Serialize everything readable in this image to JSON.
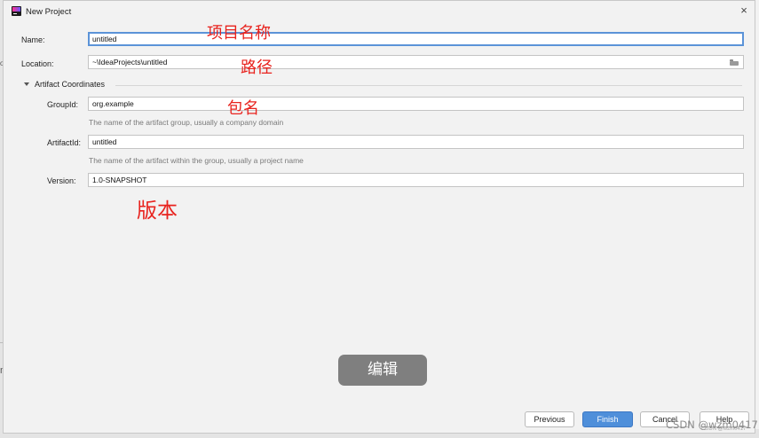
{
  "window": {
    "title": "New Project",
    "close_symbol": "×",
    "icon": "intellij-idea-icon"
  },
  "form": {
    "name": {
      "label": "Name:",
      "value": "untitled"
    },
    "location": {
      "label": "Location:",
      "value": "~\\IdeaProjects\\untitled",
      "icon": "folder-icon"
    },
    "artifact_section": {
      "label": "Artifact Coordinates",
      "expanded": true,
      "group_id": {
        "label": "GroupId:",
        "value": "org.example",
        "hint": "The name of the artifact group, usually a company domain"
      },
      "artifact_id": {
        "label": "ArtifactId:",
        "value": "untitled",
        "hint": "The name of the artifact within the group, usually a project name"
      },
      "version": {
        "label": "Version:",
        "value": "1.0-SNAPSHOT"
      }
    }
  },
  "annotations": {
    "project_name": "项目名称",
    "path": "路径",
    "package_name": "包名",
    "version": "版本",
    "color": "#e8231e"
  },
  "overlay": {
    "edit_label": "编辑"
  },
  "buttons": {
    "previous": "Previous",
    "finish": "Finish",
    "cancel": "Cancel",
    "help": "Help"
  },
  "background_fragments": {
    "left_text": "ol",
    "left_text_2": "n"
  },
  "watermark": {
    "text": "CSDN @wzm0417",
    "small": "CSDN @wzm0417"
  },
  "colors": {
    "dialog_bg": "#f2f2f2",
    "focus_border": "#5b93d8",
    "primary_button": "#4f8fda",
    "overlay_bg": "#7f7f7f"
  }
}
